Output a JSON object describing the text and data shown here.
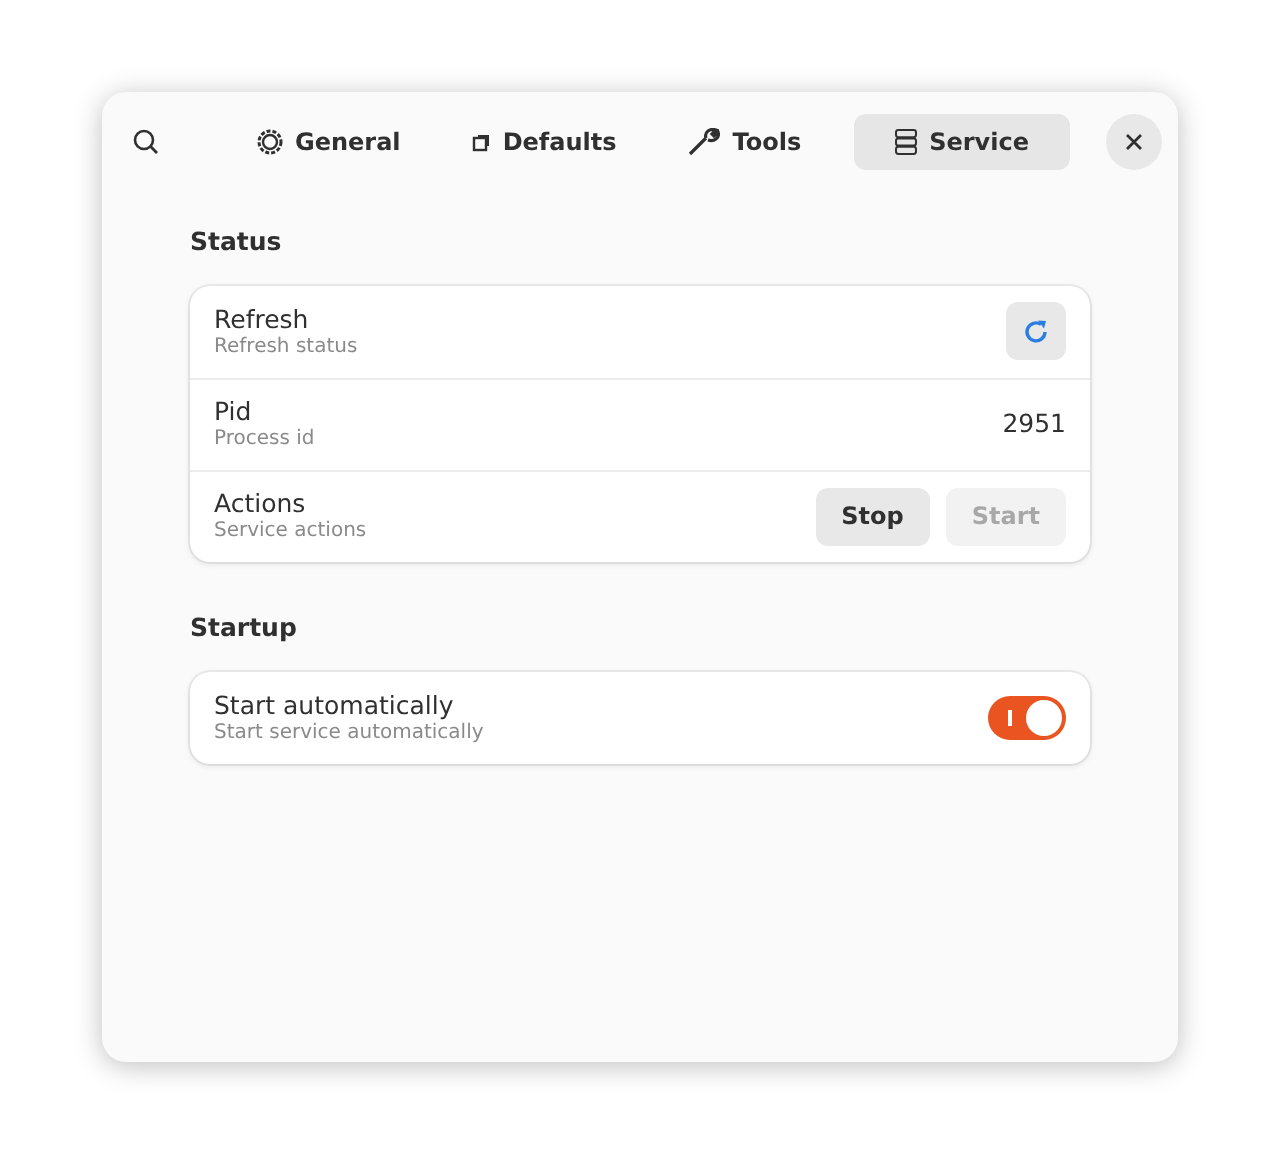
{
  "tabs": [
    {
      "label": "General",
      "kind": "gear",
      "selected": false
    },
    {
      "label": "Defaults",
      "kind": "square",
      "selected": false
    },
    {
      "label": "Tools",
      "kind": "wrench",
      "selected": false
    },
    {
      "label": "Service",
      "kind": "stack",
      "selected": true
    }
  ],
  "groups": [
    {
      "title": "Status",
      "rows": [
        {
          "kind": "button",
          "title": "Refresh",
          "subtitle": "Refresh status"
        },
        {
          "kind": "value",
          "title": "Pid",
          "subtitle": "Process id",
          "value": "2951"
        },
        {
          "kind": "actions",
          "title": "Actions",
          "subtitle": "Service actions",
          "buttons": [
            {
              "label": "Stop",
              "disabled": false
            },
            {
              "label": "Start",
              "disabled": true
            }
          ]
        }
      ]
    },
    {
      "title": "Startup",
      "rows": [
        {
          "kind": "switch",
          "title": "Start automatically",
          "subtitle": "Start service automatically",
          "on": true
        }
      ]
    }
  ]
}
